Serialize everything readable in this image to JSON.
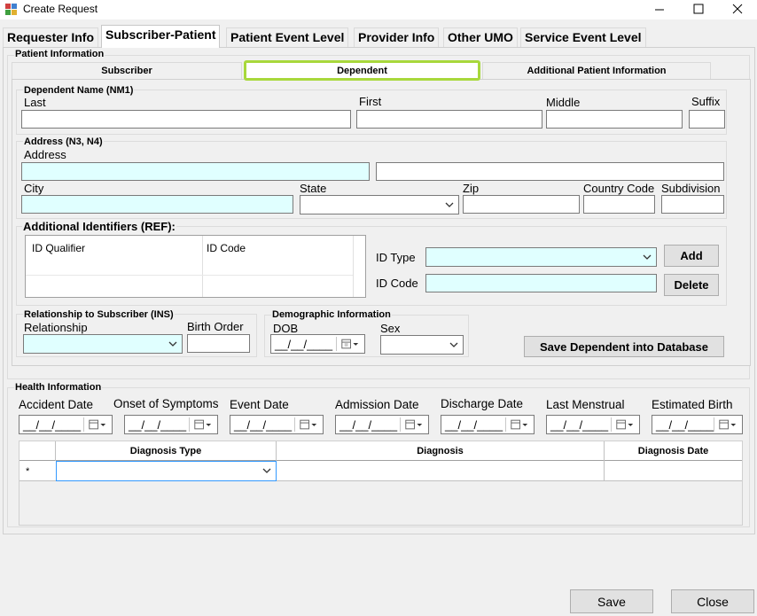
{
  "window": {
    "title": "Create Request",
    "minimize": "—",
    "maximize": "☐",
    "close": "✕"
  },
  "tabs": [
    "Requester Info",
    "Subscriber-Patient",
    "Patient Event Level",
    "Provider Info",
    "Other UMO",
    "Service Event Level"
  ],
  "patient_info": {
    "title": "Patient Information",
    "subtabs": [
      "Subscriber",
      "Dependent",
      "Additional Patient Information"
    ]
  },
  "dependent_name": {
    "title": "Dependent Name (NM1)",
    "last": "Last",
    "first": "First",
    "middle": "Middle",
    "suffix": "Suffix"
  },
  "address": {
    "title": "Address (N3, N4)",
    "address": "Address",
    "city": "City",
    "state": "State",
    "zip": "Zip",
    "country_code": "Country Code",
    "subdivision": "Subdivision"
  },
  "identifiers": {
    "title": "Additional Identifiers (REF):",
    "columns": [
      "ID Qualifier",
      "ID Code"
    ],
    "id_type": "ID Type",
    "id_code": "ID Code",
    "add": "Add",
    "delete": "Delete"
  },
  "relationship": {
    "title": "Relationship to Subscriber (INS)",
    "relationship": "Relationship",
    "birth_order": "Birth Order"
  },
  "demographic": {
    "title": "Demographic Information",
    "dob": "DOB",
    "dob_value": "__/__/____",
    "sex": "Sex"
  },
  "save_dependent": "Save Dependent into Database",
  "health": {
    "title": "Health Information",
    "dates": [
      "Accident Date",
      "Onset of Symptoms",
      "Event Date",
      "Admission Date",
      "Discharge Date",
      "Last Menstrual",
      "Estimated Birth"
    ],
    "date_placeholder": "__/__/____",
    "grid_columns": [
      "Diagnosis Type",
      "Diagnosis",
      "Diagnosis Date"
    ],
    "new_row_marker": "*"
  },
  "footer": {
    "save": "Save",
    "close": "Close"
  }
}
